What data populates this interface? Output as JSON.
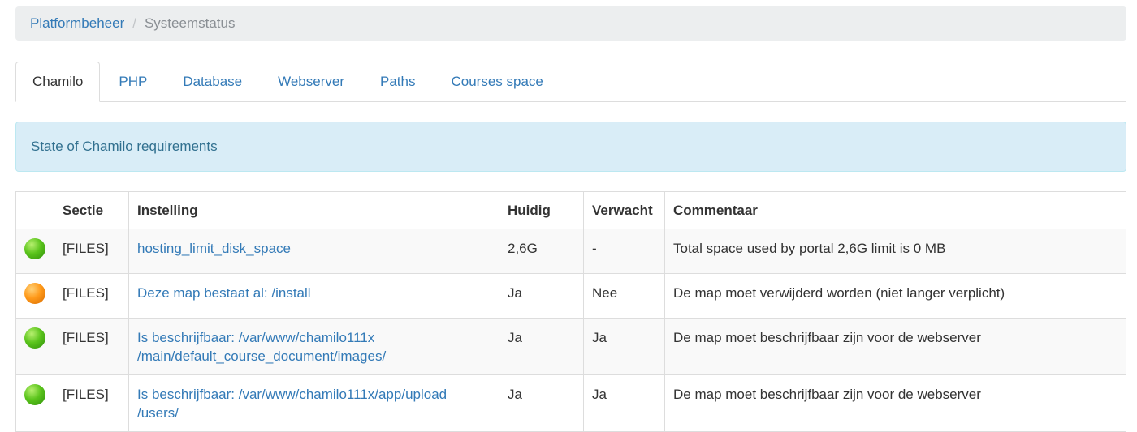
{
  "breadcrumb": {
    "parent": "Platformbeheer",
    "separator": "/",
    "current": "Systeemstatus"
  },
  "tabs": [
    {
      "label": "Chamilo",
      "active": true
    },
    {
      "label": "PHP",
      "active": false
    },
    {
      "label": "Database",
      "active": false
    },
    {
      "label": "Webserver",
      "active": false
    },
    {
      "label": "Paths",
      "active": false
    },
    {
      "label": "Courses space",
      "active": false
    }
  ],
  "alert": {
    "text": "State of Chamilo requirements"
  },
  "table": {
    "headers": [
      "",
      "Sectie",
      "Instelling",
      "Huidig",
      "Verwacht",
      "Commentaar"
    ],
    "rows": [
      {
        "status": "green",
        "section": "[FILES]",
        "setting": "hosting_limit_disk_space",
        "current": "2,6G",
        "expected": "-",
        "comment": "Total space used by portal 2,6G limit is 0 MB"
      },
      {
        "status": "orange",
        "section": "[FILES]",
        "setting": "Deze map bestaat al: /install",
        "current": "Ja",
        "expected": "Nee",
        "comment": "De map moet verwijderd worden (niet langer verplicht)"
      },
      {
        "status": "green",
        "section": "[FILES]",
        "setting": "Is beschrijfbaar: /var/www/chamilo111x /main/default_course_document/images/",
        "current": "Ja",
        "expected": "Ja",
        "comment": "De map moet beschrijfbaar zijn voor de webserver"
      },
      {
        "status": "green",
        "section": "[FILES]",
        "setting": "Is beschrijfbaar: /var/www/chamilo111x/app/upload /users/",
        "current": "Ja",
        "expected": "Ja",
        "comment": "De map moet beschrijfbaar zijn voor de webserver"
      }
    ]
  },
  "colors": {
    "green": "#5bc41c",
    "orange": "#ff9a1a",
    "link": "#337ab7"
  }
}
